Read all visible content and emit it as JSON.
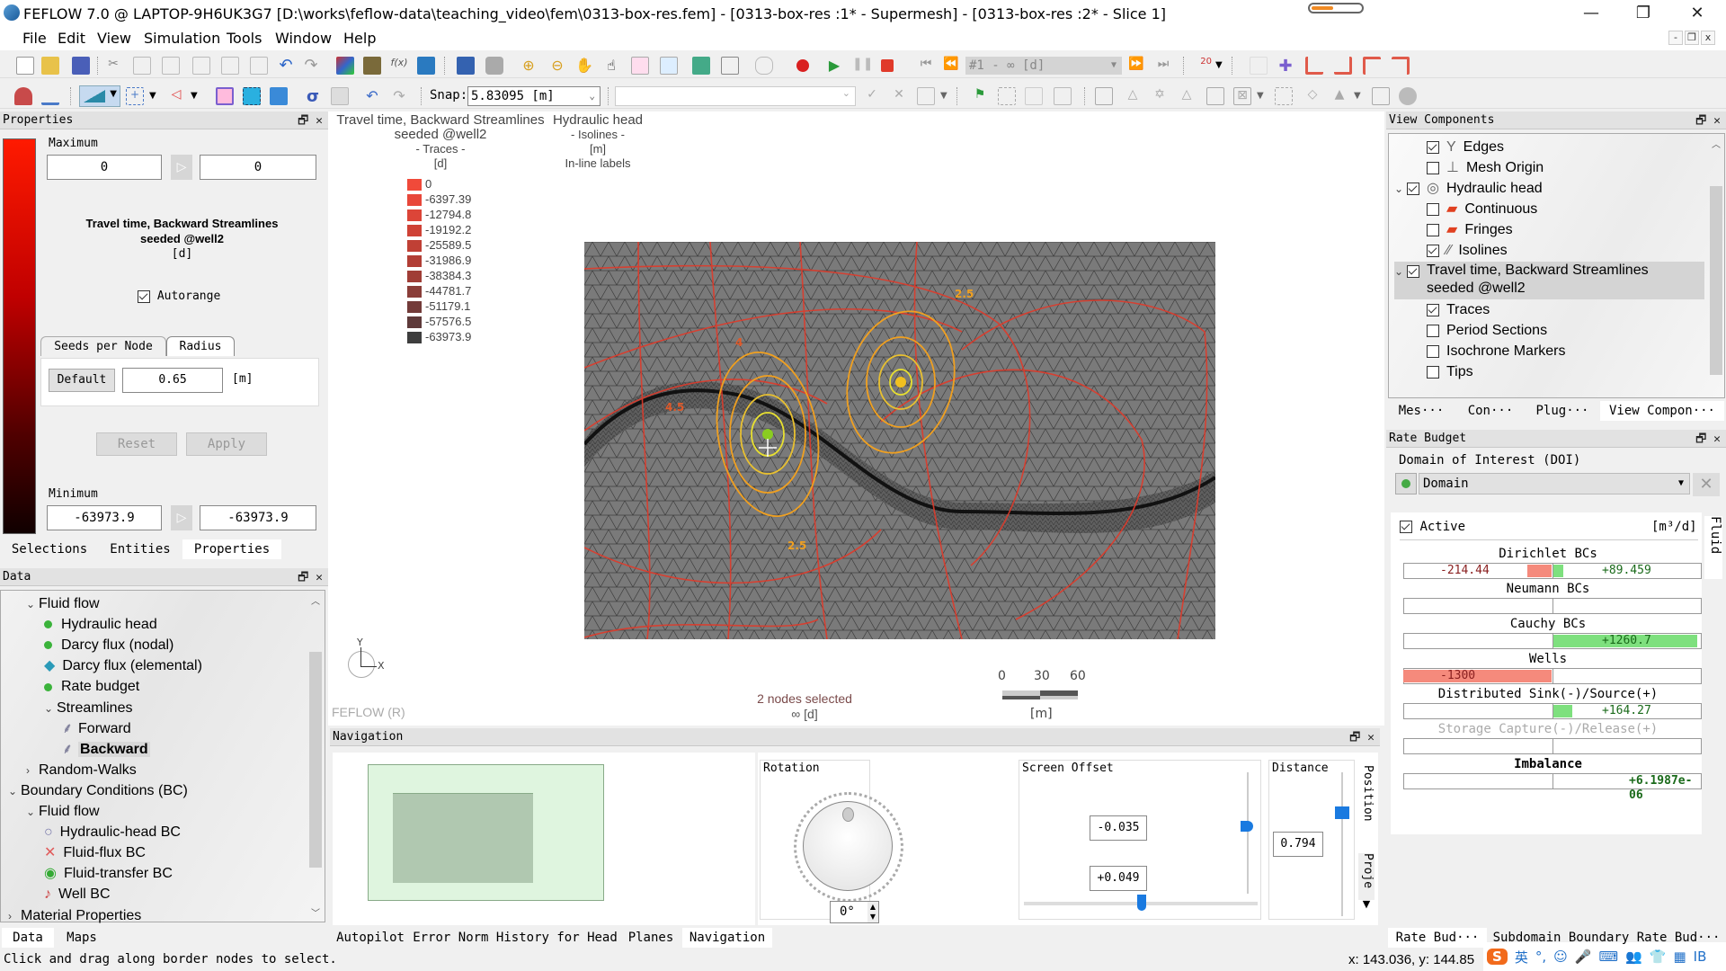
{
  "window": {
    "title": "FEFLOW 7.0 @ LAPTOP-9H6UK3G7 [D:\\works\\feflow-data\\teaching_video\\fem\\0313-box-res.fem] - [0313-box-res :1* - Supermesh] - [0313-box-res :2* - Slice 1]",
    "controls": {
      "minimize": "—",
      "restore": "❐",
      "close": "✕"
    },
    "progress_fraction": 0.45,
    "logo": "www.feflow.com"
  },
  "menu": [
    "File",
    "Edit",
    "View",
    "Simulation",
    "Tools",
    "Window",
    "Help"
  ],
  "toolbar": {
    "snap_label": "Snap:",
    "snap_value": "5.83095 [m]",
    "time_step": "#1    -   ∞  [d]",
    "scale_badge": "20"
  },
  "properties_panel": {
    "title": "Properties",
    "maximum_label": "Maximum",
    "max_left": "0",
    "max_right": "0",
    "quantity_title_line1": "Travel time, Backward Streamlines",
    "quantity_title_line2": "seeded @well2",
    "quantity_unit": "[d]",
    "autorange_label": "Autorange",
    "autorange_checked": true,
    "tabs": [
      "Seeds per Node",
      "Radius"
    ],
    "active_tab": "Radius",
    "default_button": "Default",
    "radius_value": "0.65",
    "radius_unit": "[m]",
    "reset_button": "Reset",
    "apply_button": "Apply",
    "minimum_label": "Minimum",
    "min_left": "-63973.9",
    "min_right": "-63973.9",
    "bottom_tabs": [
      "Selections",
      "Entities",
      "Properties"
    ],
    "active_bottom_tab": "Properties"
  },
  "data_panel": {
    "title": "Data",
    "tree": [
      {
        "label": "Fluid flow",
        "level": 1,
        "expander": "expanded"
      },
      {
        "label": "Hydraulic head",
        "level": 2,
        "icon": "green-dot-icon"
      },
      {
        "label": "Darcy flux (nodal)",
        "level": 2,
        "icon": "green-dot-icon"
      },
      {
        "label": "Darcy flux (elemental)",
        "level": 2,
        "icon": "cyan-diamond-icon"
      },
      {
        "label": "Rate budget",
        "level": 2,
        "icon": "green-dot-icon"
      },
      {
        "label": "Streamlines",
        "level": 2,
        "expander": "expanded"
      },
      {
        "label": "Forward",
        "level": 3,
        "icon": "streamline-icon"
      },
      {
        "label": "Backward",
        "level": 3,
        "icon": "streamline-icon",
        "selected": true
      },
      {
        "label": "Random-Walks",
        "level": 1,
        "expander": "collapsed"
      },
      {
        "label": "Boundary Conditions (BC)",
        "level": 0,
        "expander": "expanded"
      },
      {
        "label": "Fluid flow",
        "level": 1,
        "expander": "expanded"
      },
      {
        "label": "Hydraulic-head BC",
        "level": 2,
        "icon": "circle-bc-icon"
      },
      {
        "label": "Fluid-flux BC",
        "level": 2,
        "icon": "cross-bc-icon"
      },
      {
        "label": "Fluid-transfer BC",
        "level": 2,
        "icon": "transfer-bc-icon"
      },
      {
        "label": "Well BC",
        "level": 2,
        "icon": "well-bc-icon"
      },
      {
        "label": "Material Properties",
        "level": 0,
        "expander": "collapsed"
      }
    ],
    "bottom_tabs": [
      "Data",
      "Maps"
    ],
    "active_bottom_tab": "Data"
  },
  "status_bar": {
    "message": "Click and drag along border nodes to select.",
    "coords": "x: 143.036, y: 144.85"
  },
  "view": {
    "legend_traces": {
      "title_line1": "Travel time, Backward Streamlines",
      "title_line2": "seeded @well2",
      "subtitle": "- Traces -",
      "unit": "[d]",
      "entries": [
        {
          "value": "0",
          "color": "#f04a3a"
        },
        {
          "value": "-6397.39",
          "color": "#e8473a"
        },
        {
          "value": "-12794.8",
          "color": "#dc4538"
        },
        {
          "value": "-19192.2",
          "color": "#cf4236"
        },
        {
          "value": "-25589.5",
          "color": "#c04035"
        },
        {
          "value": "-31986.9",
          "color": "#b23e35"
        },
        {
          "value": "-38384.3",
          "color": "#a03d36"
        },
        {
          "value": "-44781.7",
          "color": "#8a3d38"
        },
        {
          "value": "-51179.1",
          "color": "#733b39"
        },
        {
          "value": "-57576.5",
          "color": "#5e3a3a"
        },
        {
          "value": "-63973.9",
          "color": "#3e3e3e"
        }
      ]
    },
    "legend_head": {
      "title": "Hydraulic head",
      "subtitle": "- Isolines -",
      "unit": "[m]",
      "note": "In-line labels"
    },
    "isoline_labels": [
      "2.5",
      "2.5",
      "4.5",
      "4"
    ],
    "axis_y": "Y",
    "axis_x": "X",
    "watermark": "FEFLOW (R)",
    "selection_status": "2 nodes selected",
    "time_label": "∞ [d]",
    "scale_ticks": [
      "0",
      "30",
      "60"
    ],
    "scale_unit": "[m]"
  },
  "navigation_panel": {
    "title": "Navigation",
    "rotation_label": "Rotation",
    "rotation_value": "0°",
    "screen_offset_label": "Screen Offset",
    "offset_y": "-0.035",
    "offset_x": "+0.049",
    "distance_label": "Distance",
    "distance_value": "0.794",
    "side_tabs": [
      "Position",
      "Proje"
    ],
    "bottom_tabs": [
      "Autopilot",
      "Error Norm History for Head",
      "Planes",
      "Navigation"
    ],
    "active_bottom_tab": "Navigation"
  },
  "view_components": {
    "title": "View Components",
    "items": [
      {
        "label": "Edges",
        "checked": true,
        "level": 2,
        "icon": "edges-icon"
      },
      {
        "label": "Mesh Origin",
        "checked": false,
        "level": 2,
        "icon": "mesh-origin-icon"
      },
      {
        "label": "Hydraulic head",
        "checked": true,
        "level": 1,
        "icon": "isoline-ring-icon",
        "expander": true
      },
      {
        "label": "Continuous",
        "checked": false,
        "level": 2,
        "icon": "continuous-icon"
      },
      {
        "label": "Fringes",
        "checked": false,
        "level": 2,
        "icon": "fringes-icon"
      },
      {
        "label": "Isolines",
        "checked": true,
        "level": 2,
        "icon": "isolines-icon"
      },
      {
        "label": "Travel time, Backward Streamlines seeded @well2",
        "checked": true,
        "level": 1,
        "expander": true,
        "selected": true
      },
      {
        "label": "Traces",
        "checked": true,
        "level": 2
      },
      {
        "label": "Period Sections",
        "checked": false,
        "level": 2
      },
      {
        "label": "Isochrone Markers",
        "checked": false,
        "level": 2
      },
      {
        "label": "Tips",
        "checked": false,
        "level": 2
      }
    ],
    "bottom_tabs": [
      "Mes···",
      "Con···",
      "Plug···",
      "View Compon···"
    ],
    "active_bottom_tab": "View Compon···"
  },
  "rate_budget": {
    "title": "Rate Budget",
    "doi_label": "Domain of Interest (DOI)",
    "doi_value": "Domain",
    "active_label": "Active",
    "active_checked": true,
    "unit": "[m³/d]",
    "side_tab": "Fluid",
    "rows": [
      {
        "label": "Dirichlet BCs",
        "neg": "-214.44",
        "pos": "+89.459",
        "neg_fraction": 0.165,
        "pos_fraction": 0.069
      },
      {
        "label": "Neumann BCs",
        "neg": "",
        "pos": "",
        "neg_fraction": 0,
        "pos_fraction": 0
      },
      {
        "label": "Cauchy BCs",
        "neg": "",
        "pos": "+1260.7",
        "neg_fraction": 0,
        "pos_fraction": 0.97
      },
      {
        "label": "Wells",
        "neg": "-1300",
        "pos": "",
        "neg_fraction": 1.0,
        "pos_fraction": 0
      },
      {
        "label": "Distributed Sink(-)/Source(+)",
        "neg": "",
        "pos": "+164.27",
        "neg_fraction": 0,
        "pos_fraction": 0.126
      },
      {
        "label": "Storage Capture(-)/Release(+)",
        "neg": "",
        "pos": "",
        "neg_fraction": 0,
        "pos_fraction": 0,
        "disabled": true
      },
      {
        "label": "Imbalance",
        "neg": "",
        "pos": "+6.1987e-06",
        "neg_fraction": 0,
        "pos_fraction": 0,
        "bold": true
      }
    ],
    "bottom_tabs": [
      "Rate Bud···",
      "Subdomain Boundary Rate Bud···"
    ],
    "active_bottom_tab": "Rate Bud···"
  },
  "ime_toolbar": [
    "S",
    "英",
    "°,",
    "☺",
    "🎤",
    "⌨",
    "👥",
    "👕",
    "▦",
    "IB"
  ]
}
